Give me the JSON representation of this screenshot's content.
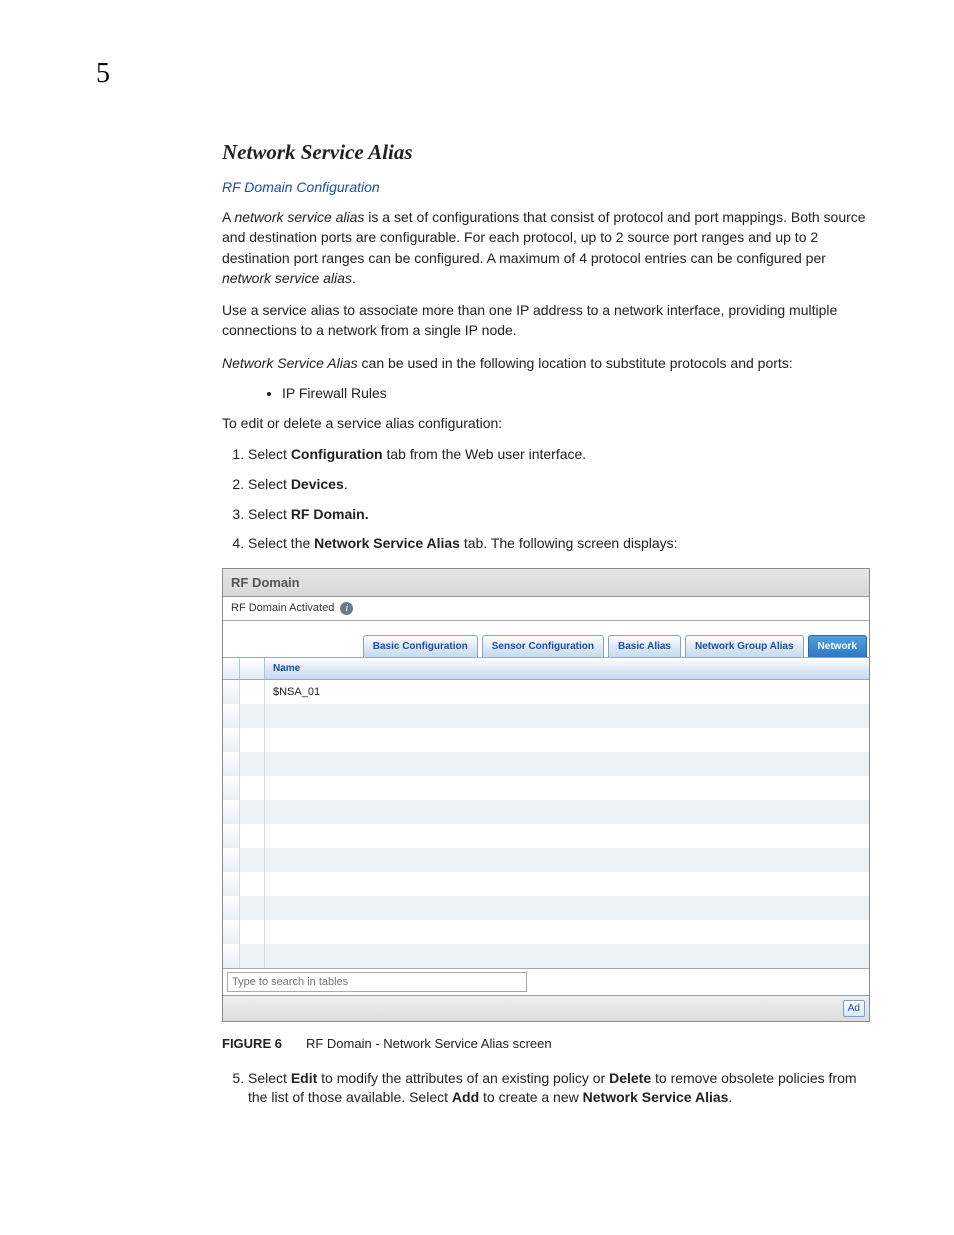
{
  "page_number": "5",
  "heading": "Network Service Alias",
  "subhead_link": "RF Domain Configuration",
  "para1_a": "A ",
  "para1_b": "network service alias",
  "para1_c": " is a set of configurations that consist of protocol and port mappings. Both source and destination ports are configurable. For each protocol, up to 2 source port ranges and up to 2 destination port ranges can be configured. A maximum of 4 protocol entries can be configured per ",
  "para1_d": "network service alias",
  "para1_e": ".",
  "para2": "Use a service alias to associate more than one IP address to a network interface, providing multiple connections to a network from a single IP node.",
  "para3_a": "Network Service Alias",
  "para3_b": " can be used in the following location to substitute protocols and ports:",
  "bullet1": "IP Firewall Rules",
  "para4": "To edit or delete a service alias configuration:",
  "step1_a": "Select ",
  "step1_b": "Configuration",
  "step1_c": " tab from the Web user interface.",
  "step2_a": "Select ",
  "step2_b": "Devices",
  "step2_c": ".",
  "step3_a": "Select ",
  "step3_b": "RF Domain.",
  "step4_a": "Select the ",
  "step4_b": "Network Service Alias",
  "step4_c": " tab. The following screen displays:",
  "panel": {
    "title": "RF Domain",
    "status": "RF Domain Activated",
    "tabs": [
      "Basic Configuration",
      "Sensor Configuration",
      "Basic Alias",
      "Network Group Alias",
      "Network"
    ],
    "active_tab_index": 4,
    "col_name": "Name",
    "rows": [
      "$NSA_01",
      "",
      "",
      "",
      "",
      "",
      "",
      "",
      "",
      "",
      "",
      ""
    ],
    "search_placeholder": "Type to search in tables",
    "toolbar_btn": "Ad"
  },
  "fig_num": "FIGURE 6",
  "fig_caption": "RF Domain - Network Service Alias screen",
  "step5_a": "Select ",
  "step5_b": "Edit",
  "step5_c": " to modify the attributes of an existing policy or ",
  "step5_d": "Delete",
  "step5_e": " to remove obsolete policies from the list of those available. Select ",
  "step5_f": "Add",
  "step5_g": " to create a new ",
  "step5_h": "Network Service Alias",
  "step5_i": "."
}
